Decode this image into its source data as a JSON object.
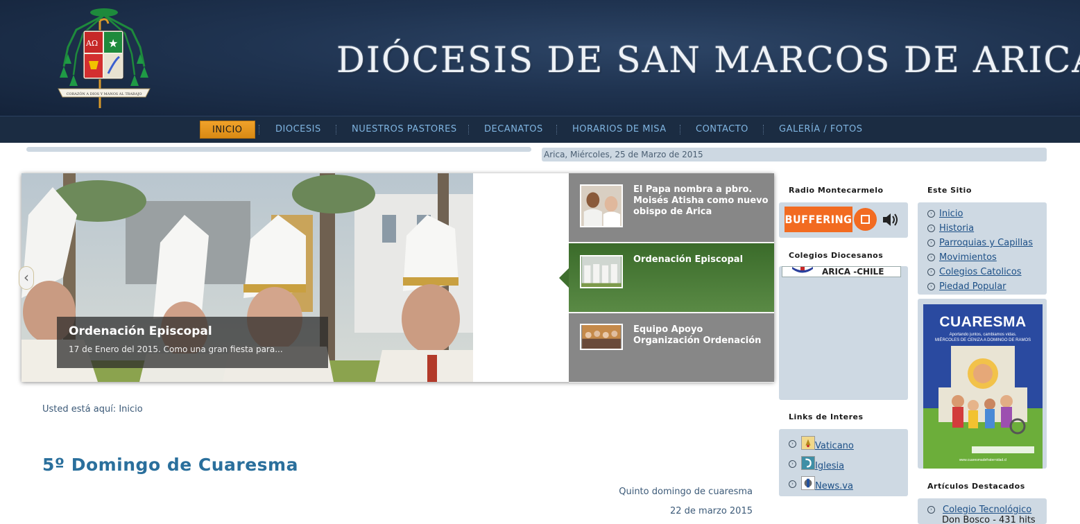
{
  "header": {
    "site_title": "DIÓCESIS DE SAN MARCOS DE ARICA",
    "crest_motto": "CORAZÓN A DIOS Y MANOS AL TRABAJO"
  },
  "nav": {
    "items": [
      "INICIO",
      "DIOCESIS",
      "NUESTROS PASTORES",
      "DECANATOS",
      "HORARIOS DE MISA",
      "CONTACTO",
      "GALERÍA / FOTOS"
    ],
    "active": "INICIO"
  },
  "date_line": "Arica, Miércoles, 25 de Marzo de 2015",
  "slider": {
    "caption_title": "Ordenación Episcopal",
    "caption_text": "17 de Enero del 2015.   Como una gran fiesta para...",
    "thumbs": [
      {
        "label": "El Papa nombra a pbro. Moisés Atisha como nuevo obispo de Arica",
        "active": false
      },
      {
        "label": "Ordenación Episcopal",
        "active": true
      },
      {
        "label": "Equipo Apoyo Organización Ordenación",
        "active": false
      }
    ],
    "prev_icon": "chevron-left-icon",
    "next_icon": "chevron-right-icon"
  },
  "breadcrumb": "Usted está aquí: Inicio",
  "article": {
    "title": "5º Domingo de Cuaresma",
    "subtitle": "Quinto domingo de cuaresma",
    "date": "22 de marzo 2015"
  },
  "sidebar1": {
    "radio_heading": "Radio Montecarmelo",
    "radio_status": "BUFFERING",
    "colegios_heading": "Colegios Diocesanos",
    "colegios_strip": "ARICA -CHILE",
    "links_heading": "Links de Interes",
    "links": [
      "Vaticano",
      " Iglesia",
      "News.va"
    ]
  },
  "sidebar2": {
    "site_heading": "Este Sitio",
    "site_links": [
      "Inicio",
      "Historia",
      "Parroquias y Capillas",
      "Movimientos",
      "Colegios Catolicos",
      "Piedad Popular"
    ],
    "poster": {
      "title": "CUARESMA",
      "subtitle1": "Aportando juntos, cambiamos vidas.",
      "subtitle2": "MIÉRCOLES DE CENIZA A DOMINGO DE RAMOS",
      "footer": "www.cuaresmadefraternidad.cl"
    },
    "featured_heading": "Artículos Destacados",
    "featured": [
      "Colegio Tecnológico",
      "Don Bosco - 431 hits"
    ]
  },
  "colors": {
    "nav_active": "#e8951f",
    "header_bg": "#1f3350",
    "panel": "#ced9e3",
    "title_blue": "#2a6f9c",
    "thumb_active": "#4a7b38",
    "radio_orange": "#f26b21"
  }
}
